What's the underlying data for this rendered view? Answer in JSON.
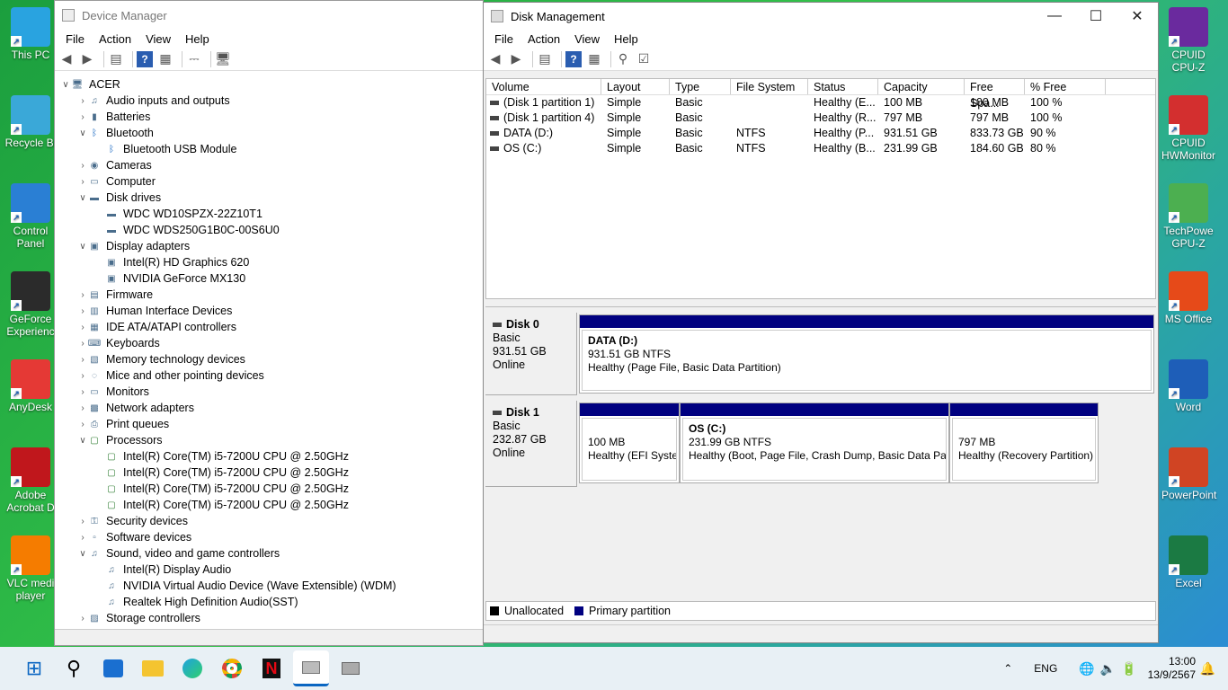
{
  "desktop": {
    "left_icons": [
      {
        "label": "This PC",
        "icon": "monitor-icon",
        "color": "#29a3e0"
      },
      {
        "label": "Recycle Bi",
        "icon": "recycle-bin-icon",
        "color": "#3aa8d8"
      },
      {
        "label": "Control Panel",
        "icon": "control-panel-icon",
        "color": "#2a7fd4"
      },
      {
        "label": "GeForce Experienc",
        "icon": "geforce-icon",
        "color": "#2b2b2b"
      },
      {
        "label": "AnyDesk",
        "icon": "anydesk-icon",
        "color": "#e53935"
      },
      {
        "label": "Adobe Acrobat D",
        "icon": "acrobat-icon",
        "color": "#c0171c"
      },
      {
        "label": "VLC medi player",
        "icon": "vlc-icon",
        "color": "#f57c00"
      }
    ],
    "right_icons": [
      {
        "label": "CPUID CPU-Z",
        "icon": "cpuz-icon",
        "color": "#6a2a9e"
      },
      {
        "label": "CPUID HWMonitor",
        "icon": "hwmonitor-icon",
        "color": "#d32f2f"
      },
      {
        "label": "TechPowe GPU-Z",
        "icon": "gpuz-icon",
        "color": "#4caf50"
      },
      {
        "label": "MS Office",
        "icon": "office-icon",
        "color": "#e64a19"
      },
      {
        "label": "Word",
        "icon": "word-icon",
        "color": "#1e5eb8"
      },
      {
        "label": "PowerPoint",
        "icon": "powerpoint-icon",
        "color": "#d04423"
      },
      {
        "label": "Excel",
        "icon": "excel-icon",
        "color": "#1b7a43"
      }
    ]
  },
  "device_manager": {
    "title": "Device Manager",
    "menu": [
      "File",
      "Action",
      "View",
      "Help"
    ],
    "tree": [
      {
        "label": "ACER",
        "level": 0,
        "chev": "v",
        "icon": "computer-icon"
      },
      {
        "label": "Audio inputs and outputs",
        "level": 1,
        "chev": ">",
        "icon": "speaker-icon"
      },
      {
        "label": "Batteries",
        "level": 1,
        "chev": ">",
        "icon": "battery-icon"
      },
      {
        "label": "Bluetooth",
        "level": 1,
        "chev": "v",
        "icon": "bluetooth-icon"
      },
      {
        "label": "Bluetooth USB Module",
        "level": 2,
        "chev": "",
        "icon": "bluetooth-icon"
      },
      {
        "label": "Cameras",
        "level": 1,
        "chev": ">",
        "icon": "camera-icon"
      },
      {
        "label": "Computer",
        "level": 1,
        "chev": ">",
        "icon": "monitor-icon"
      },
      {
        "label": "Disk drives",
        "level": 1,
        "chev": "v",
        "icon": "disk-icon"
      },
      {
        "label": "WDC WD10SPZX-22Z10T1",
        "level": 2,
        "chev": "",
        "icon": "disk-icon"
      },
      {
        "label": "WDC WDS250G1B0C-00S6U0",
        "level": 2,
        "chev": "",
        "icon": "disk-icon"
      },
      {
        "label": "Display adapters",
        "level": 1,
        "chev": "v",
        "icon": "display-adapter-icon"
      },
      {
        "label": "Intel(R) HD Graphics 620",
        "level": 2,
        "chev": "",
        "icon": "display-adapter-icon"
      },
      {
        "label": "NVIDIA GeForce MX130",
        "level": 2,
        "chev": "",
        "icon": "display-adapter-icon"
      },
      {
        "label": "Firmware",
        "level": 1,
        "chev": ">",
        "icon": "firmware-icon"
      },
      {
        "label": "Human Interface Devices",
        "level": 1,
        "chev": ">",
        "icon": "hid-icon"
      },
      {
        "label": "IDE ATA/ATAPI controllers",
        "level": 1,
        "chev": ">",
        "icon": "ide-icon"
      },
      {
        "label": "Keyboards",
        "level": 1,
        "chev": ">",
        "icon": "keyboard-icon"
      },
      {
        "label": "Memory technology devices",
        "level": 1,
        "chev": ">",
        "icon": "memory-icon"
      },
      {
        "label": "Mice and other pointing devices",
        "level": 1,
        "chev": ">",
        "icon": "mouse-icon"
      },
      {
        "label": "Monitors",
        "level": 1,
        "chev": ">",
        "icon": "monitor-icon"
      },
      {
        "label": "Network adapters",
        "level": 1,
        "chev": ">",
        "icon": "network-icon"
      },
      {
        "label": "Print queues",
        "level": 1,
        "chev": ">",
        "icon": "printer-icon"
      },
      {
        "label": "Processors",
        "level": 1,
        "chev": "v",
        "icon": "processor-icon"
      },
      {
        "label": "Intel(R) Core(TM) i5-7200U CPU @ 2.50GHz",
        "level": 2,
        "chev": "",
        "icon": "processor-icon"
      },
      {
        "label": "Intel(R) Core(TM) i5-7200U CPU @ 2.50GHz",
        "level": 2,
        "chev": "",
        "icon": "processor-icon"
      },
      {
        "label": "Intel(R) Core(TM) i5-7200U CPU @ 2.50GHz",
        "level": 2,
        "chev": "",
        "icon": "processor-icon"
      },
      {
        "label": "Intel(R) Core(TM) i5-7200U CPU @ 2.50GHz",
        "level": 2,
        "chev": "",
        "icon": "processor-icon"
      },
      {
        "label": "Security devices",
        "level": 1,
        "chev": ">",
        "icon": "security-icon"
      },
      {
        "label": "Software devices",
        "level": 1,
        "chev": ">",
        "icon": "software-device-icon"
      },
      {
        "label": "Sound, video and game controllers",
        "level": 1,
        "chev": "v",
        "icon": "speaker-icon"
      },
      {
        "label": "Intel(R) Display Audio",
        "level": 2,
        "chev": "",
        "icon": "speaker-icon"
      },
      {
        "label": "NVIDIA Virtual Audio Device (Wave Extensible) (WDM)",
        "level": 2,
        "chev": "",
        "icon": "speaker-icon"
      },
      {
        "label": "Realtek High Definition Audio(SST)",
        "level": 2,
        "chev": "",
        "icon": "speaker-icon"
      },
      {
        "label": "Storage controllers",
        "level": 1,
        "chev": ">",
        "icon": "storage-controller-icon"
      }
    ]
  },
  "disk_management": {
    "title": "Disk Management",
    "menu": [
      "File",
      "Action",
      "View",
      "Help"
    ],
    "columns": [
      "Volume",
      "Layout",
      "Type",
      "File System",
      "Status",
      "Capacity",
      "Free Spa...",
      "% Free"
    ],
    "rows": [
      [
        "(Disk 1 partition 1)",
        "Simple",
        "Basic",
        "",
        "Healthy (E...",
        "100 MB",
        "100 MB",
        "100 %"
      ],
      [
        "(Disk 1 partition 4)",
        "Simple",
        "Basic",
        "",
        "Healthy (R...",
        "797 MB",
        "797 MB",
        "100 %"
      ],
      [
        "DATA (D:)",
        "Simple",
        "Basic",
        "NTFS",
        "Healthy (P...",
        "931.51 GB",
        "833.73 GB",
        "90 %"
      ],
      [
        "OS (C:)",
        "Simple",
        "Basic",
        "NTFS",
        "Healthy (B...",
        "231.99 GB",
        "184.60 GB",
        "80 %"
      ]
    ],
    "disk0": {
      "name": "Disk 0",
      "type": "Basic",
      "size": "931.51 GB",
      "state": "Online",
      "partitions": [
        {
          "title": "DATA  (D:)",
          "line1": "931.51 GB NTFS",
          "line2": "Healthy (Page File, Basic Data Partition)"
        }
      ]
    },
    "disk1": {
      "name": "Disk 1",
      "type": "Basic",
      "size": "232.87 GB",
      "state": "Online",
      "partitions": [
        {
          "title": "",
          "line1": "100 MB",
          "line2": "Healthy (EFI System"
        },
        {
          "title": "OS  (C:)",
          "line1": "231.99 GB NTFS",
          "line2": "Healthy (Boot, Page File, Crash Dump, Basic Data Parti"
        },
        {
          "title": "",
          "line1": "797 MB",
          "line2": "Healthy (Recovery Partition)"
        }
      ]
    },
    "legend": [
      {
        "label": "Unallocated",
        "color": "#000000"
      },
      {
        "label": "Primary partition",
        "color": "#000080"
      }
    ]
  },
  "taskbar": {
    "apps": [
      "start-icon",
      "search-icon",
      "store-icon",
      "file-explorer-icon",
      "edge-icon",
      "chrome-icon",
      "netflix-icon",
      "disk-management-icon",
      "device-manager-icon"
    ],
    "lang": "ENG",
    "time": "13:00",
    "date": "13/9/2567"
  }
}
